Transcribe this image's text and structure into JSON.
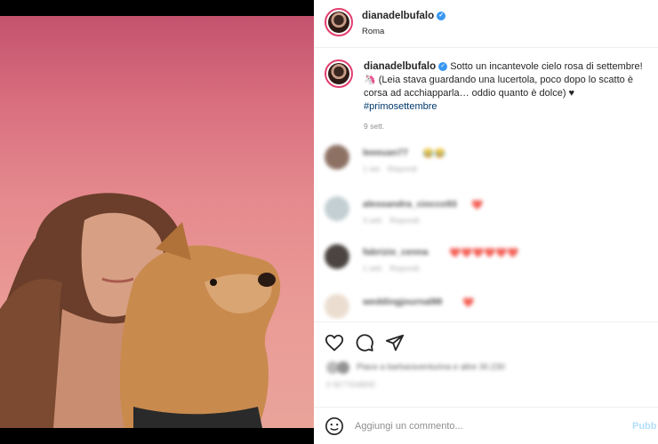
{
  "post": {
    "username": "dianadelbufalo",
    "location": "Roma",
    "caption_username": "dianadelbufalo",
    "caption_text": "Sotto un incantevole cielo rosa di settembre! 🦄 (Leia stava guardando una lucertola, poco dopo lo scatto è corsa ad acchiapparla… oddio quanto è dolce) ♥",
    "hashtag": "#primosettembre",
    "time": "9 sett."
  },
  "comments": [
    {
      "name": "leeeuan77",
      "text": "😂😂",
      "time": "1 set.",
      "reply": "Rispondi",
      "avatar_color": "#7a5a4a"
    },
    {
      "name": "alessandra_ciocco93",
      "text": "❤️",
      "time": "3 sett.",
      "reply": "Rispondi",
      "avatar_color": "#b9c7cc"
    },
    {
      "name": "fabrizio_cenna",
      "text": "❤️❤️❤️❤️❤️❤️",
      "time": "1 sett.",
      "reply": "Rispondi",
      "avatar_color": "#2c2420"
    },
    {
      "name": "weddingjournal88",
      "text": "❤️",
      "time": "",
      "reply": "",
      "avatar_color": "#e8d8c8"
    }
  ],
  "actions": {
    "like_icon": "heart-icon",
    "comment_icon": "comment-icon",
    "share_icon": "share-icon"
  },
  "likes": {
    "text": "Piace a barbaraventurina e altre 30.230",
    "date": "9 SETTEMBRE"
  },
  "comment_bar": {
    "placeholder": "Aggiungi un commento...",
    "publish_label": "Pubb"
  },
  "colors": {
    "verified": "#3897f0",
    "hashtag": "#00376b",
    "publish": "#b2dffc",
    "ring": "#e23d6e"
  }
}
